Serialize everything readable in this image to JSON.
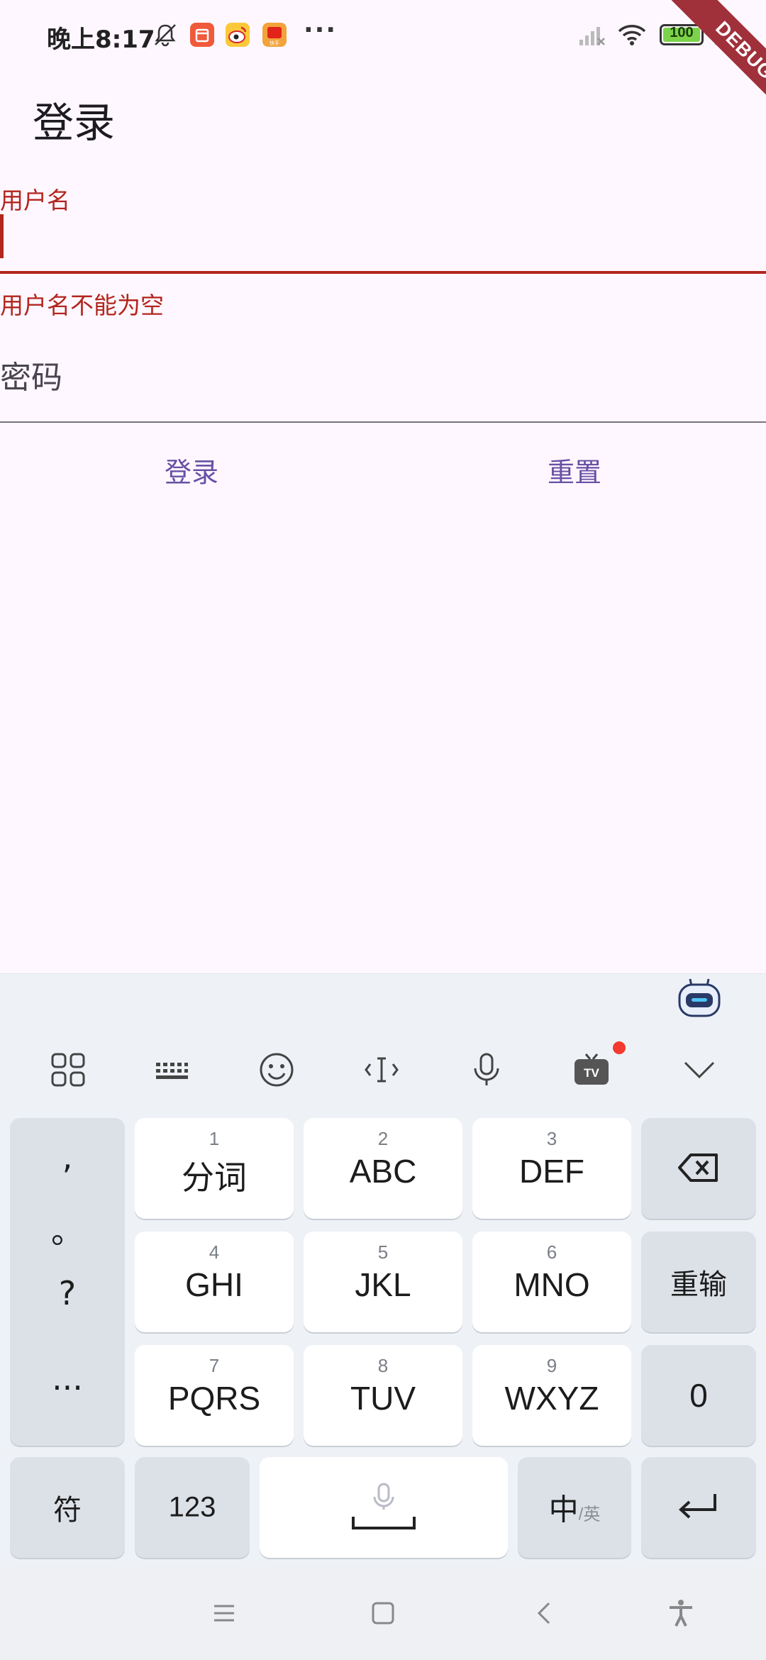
{
  "status_bar": {
    "time": "晚上8:17",
    "more": "···",
    "battery": "100",
    "icons": [
      "mute-icon",
      "app-notification-icon",
      "weibo-icon",
      "app-notification-icon-2",
      "signal-icon",
      "wifi-icon",
      "charging-icon"
    ]
  },
  "debug_banner": "DEBUG",
  "app_bar": {
    "title": "登录"
  },
  "form": {
    "username": {
      "label": "用户名",
      "error": "用户名不能为空",
      "value": ""
    },
    "password": {
      "hint": "密码",
      "value": ""
    },
    "login_button": "登录",
    "reset_button": "重置"
  },
  "keyboard": {
    "toolbar_icons": [
      "grid-icon",
      "keyboard-icon",
      "emoji-icon",
      "cursor-icon",
      "microphone-icon",
      "tv-icon",
      "collapse-chevron-icon"
    ],
    "punctuation": [
      ",",
      "。",
      "?",
      "..."
    ],
    "keys": [
      {
        "num": "1",
        "label": "分词"
      },
      {
        "num": "2",
        "label": "ABC"
      },
      {
        "num": "3",
        "label": "DEF"
      },
      {
        "num": "4",
        "label": "GHI"
      },
      {
        "num": "5",
        "label": "JKL"
      },
      {
        "num": "6",
        "label": "MNO"
      },
      {
        "num": "7",
        "label": "PQRS"
      },
      {
        "num": "8",
        "label": "TUV"
      },
      {
        "num": "9",
        "label": "WXYZ"
      }
    ],
    "reenter": "重输",
    "zero": "0",
    "symbols": "符",
    "numbers": "123",
    "lang_main": "中",
    "lang_alt": "/英"
  },
  "colors": {
    "background": "#FEF7FF",
    "error": "#B3261E",
    "primary": "#6750A4",
    "keyboard_bg": "#EEF2F7"
  }
}
